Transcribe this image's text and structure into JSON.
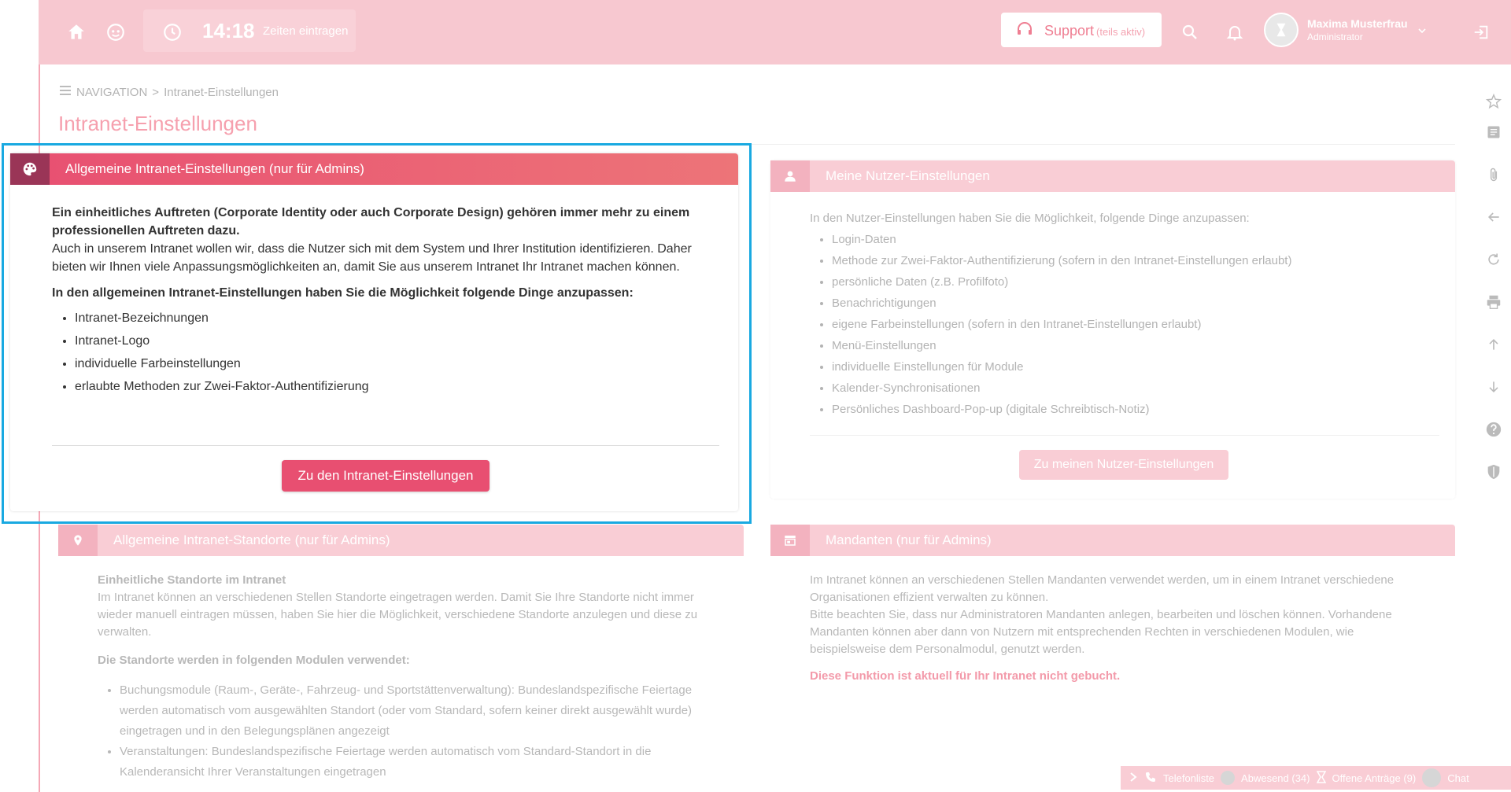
{
  "topbar": {
    "time": "14:18",
    "time_link": "Zeiten eintragen",
    "support_label": "Support",
    "support_sub": "(teils aktiv)",
    "user_name": "Maxima Musterfrau",
    "user_role": "Administrator"
  },
  "breadcrumb": {
    "nav": "NAVIGATION",
    "separator": ">",
    "current": "Intranet-Einstellungen"
  },
  "page_title": "Intranet-Einstellungen",
  "panel_general": {
    "title": "Allgemeine Intranet-Einstellungen (nur für Admins)",
    "intro_bold": "Ein einheitliches Auftreten (Corporate Identity oder auch Corporate Design) gehören immer mehr zu einem professionellen Auftreten dazu.",
    "intro_text": "Auch in unserem Intranet wollen wir, dass die Nutzer sich mit dem System und Ihrer Institution identifizieren. Daher bieten wir Ihnen viele Anpassungsmöglichkeiten an, damit Sie aus unserem Intranet Ihr Intranet machen können.",
    "list_heading": "In den allgemeinen Intranet-Einstellungen haben Sie die Möglichkeit folgende Dinge anzupassen:",
    "items": [
      "Intranet-Bezeichnungen",
      "Intranet-Logo",
      "individuelle Farbeinstellungen",
      "erlaubte Methoden zur Zwei-Faktor-Authentifizierung"
    ],
    "button": "Zu den Intranet-Einstellungen"
  },
  "panel_user": {
    "title": "Meine Nutzer-Einstellungen",
    "intro": "In den Nutzer-Einstellungen haben Sie die Möglichkeit, folgende Dinge anzupassen:",
    "items": [
      "Login-Daten",
      "Methode zur Zwei-Faktor-Authentifizierung (sofern in den Intranet-Einstellungen erlaubt)",
      "persönliche Daten (z.B. Profilfoto)",
      "Benachrichtigungen",
      "eigene Farbeinstellungen (sofern in den Intranet-Einstellungen erlaubt)",
      "Menü-Einstellungen",
      "individuelle Einstellungen für Module",
      "Kalender-Synchronisationen",
      "Persönliches Dashboard-Pop-up (digitale Schreibtisch-Notiz)"
    ],
    "button": "Zu meinen Nutzer-Einstellungen"
  },
  "panel_locations": {
    "title": "Allgemeine Intranet-Standorte (nur für Admins)",
    "subtitle": "Einheitliche Standorte im Intranet",
    "text": "Im Intranet können an verschiedenen Stellen Standorte eingetragen werden. Damit Sie Ihre Standorte nicht immer wieder manuell eintragen müssen, haben Sie hier die Möglichkeit, verschiedene Standorte anzulegen und diese zu verwalten.",
    "list_heading": "Die Standorte werden in folgenden Modulen verwendet:",
    "items": [
      "Buchungsmodule (Raum-, Geräte-, Fahrzeug- und Sportstättenverwaltung): Bundeslandspezifische Feiertage werden automatisch vom ausgewählten Standort (oder vom Standard, sofern keiner direkt ausgewählt wurde) eingetragen und in den Belegungsplänen angezeigt",
      "Veranstaltungen: Bundeslandspezifische Feiertage werden automatisch vom Standard-Standort in die Kalenderansicht Ihrer Veranstaltungen eingetragen"
    ]
  },
  "panel_clients": {
    "title": "Mandanten (nur für Admins)",
    "text1": "Im Intranet können an verschiedenen Stellen Mandanten verwendet werden, um in einem Intranet verschiedene Organisationen effizient verwalten zu können.",
    "text2": "Bitte beachten Sie, dass nur Administratoren Mandanten anlegen, bearbeiten und löschen können. Vorhandene Mandanten können aber dann von Nutzern mit entsprechenden Rechten in verschiedenen Modulen, wie beispielsweise dem Personalmodul, genutzt werden.",
    "warning": "Diese Funktion ist aktuell für Ihr Intranet nicht gebucht."
  },
  "bottombar": {
    "phone": "Telefonliste",
    "absent": "Abwesend (34)",
    "requests": "Offene Anträge (9)",
    "chat": "Chat"
  },
  "colors": {
    "accent": "#e84f71",
    "header_faded": "#f7c8d0",
    "highlight": "#19a9e1"
  },
  "icons": [
    "home-icon",
    "face-icon",
    "clock-icon",
    "headset-icon",
    "search-icon",
    "bell-icon",
    "logout-icon",
    "star-icon",
    "notes-icon",
    "paperclip-icon",
    "back-icon",
    "refresh-icon",
    "print-icon",
    "arrow-up-icon",
    "arrow-down-icon",
    "help-icon",
    "shield-icon",
    "palette-icon",
    "user-icon",
    "location-icon",
    "store-icon",
    "phone-icon"
  ]
}
